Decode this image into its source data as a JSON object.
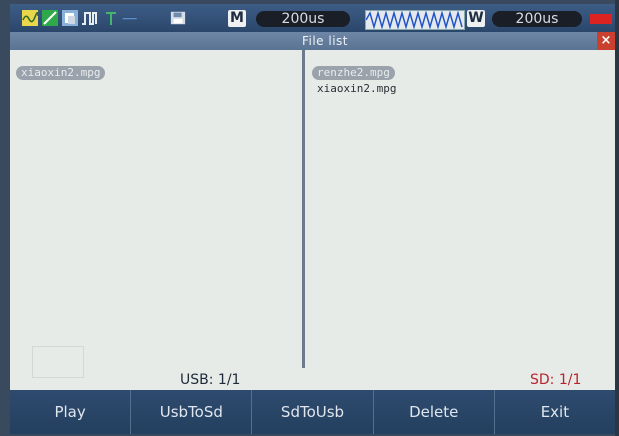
{
  "status": {
    "mode_letter": "M",
    "timebase_main": "200us",
    "window_letter": "W",
    "timebase_window": "200us"
  },
  "window": {
    "title": "File list",
    "close_glyph": "×"
  },
  "left_panel": {
    "files": [
      "xiaoxin2.mpg"
    ],
    "selected_index": 0,
    "count_label": "USB: 1/1"
  },
  "right_panel": {
    "files": [
      "renzhe2.mpg",
      "xiaoxin2.mpg"
    ],
    "selected_index": 0,
    "count_label": "SD: 1/1"
  },
  "softkeys": [
    "Play",
    "UsbToSd",
    "SdToUsb",
    "Delete",
    "Exit"
  ],
  "colors": {
    "sd_count": "#b8232d",
    "accent_bar": "#2e4a6e"
  },
  "icons": [
    "waveform-icon",
    "ramp-icon",
    "copy-icon",
    "pulse-icon",
    "trigger-icon",
    "floppy-disk-icon",
    "record-indicator-icon"
  ]
}
